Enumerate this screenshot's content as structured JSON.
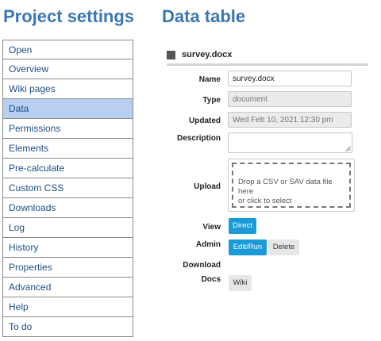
{
  "left_heading": "Project settings",
  "right_heading": "Data table",
  "sidebar": {
    "items": [
      {
        "label": "Open"
      },
      {
        "label": "Overview"
      },
      {
        "label": "Wiki pages"
      },
      {
        "label": "Data",
        "active": true
      },
      {
        "label": "Permissions"
      },
      {
        "label": "Elements"
      },
      {
        "label": "Pre-calculate"
      },
      {
        "label": "Custom CSS"
      },
      {
        "label": "Downloads"
      },
      {
        "label": "Log"
      },
      {
        "label": "History"
      },
      {
        "label": "Properties"
      },
      {
        "label": "Advanced"
      },
      {
        "label": "Help"
      },
      {
        "label": "To do"
      }
    ]
  },
  "file": {
    "icon": "file-square-icon",
    "name": "survey.docx"
  },
  "form": {
    "name_label": "Name",
    "name_value": "survey.docx",
    "type_label": "Type",
    "type_placeholder": "document",
    "updated_label": "Updated",
    "updated_placeholder": "Wed Feb 10, 2021 12:30 pm",
    "description_label": "Description",
    "upload_label": "Upload",
    "upload_text_1": "Drop a CSV or SAV data file here",
    "upload_text_2": "or click to select",
    "view_label": "View",
    "view_button": "Direct",
    "admin_label": "Admin",
    "edit_button": "Edit/Run",
    "delete_button": "Delete",
    "download_label": "Download",
    "docs_label": "Docs",
    "wiki_button": "Wiki"
  },
  "colors": {
    "heading": "#3a78b5",
    "active_item": "#b9cff1",
    "primary_button": "#1a9bd7"
  }
}
